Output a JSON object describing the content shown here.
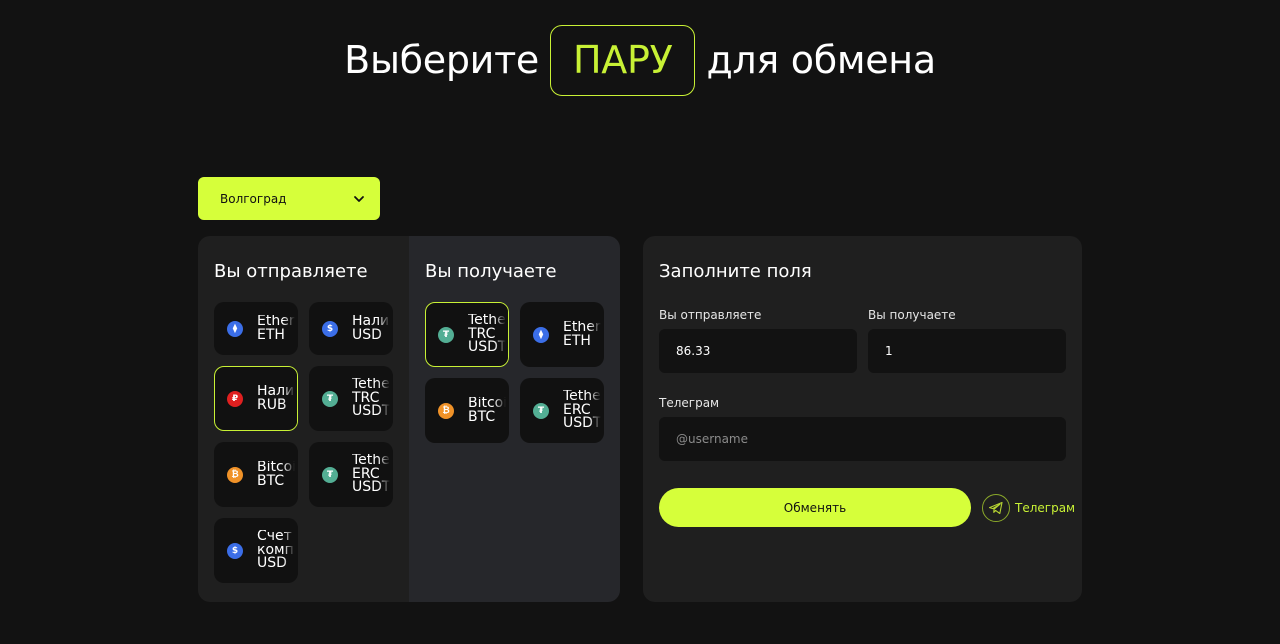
{
  "heading": {
    "before": "Выберите",
    "accent": "ПАРУ",
    "after": "для обмена"
  },
  "city": {
    "selected": "Волгоград",
    "icon": "chevron-down-icon"
  },
  "send": {
    "title": "Вы отправляете",
    "items": [
      {
        "label": "Ethereum\nETH",
        "icon": "ethereum-icon"
      },
      {
        "label": "Наличные\nUSD",
        "icon": "dollar-icon"
      },
      {
        "label": "Наличные\nRUB",
        "icon": "ruble-icon"
      },
      {
        "label": "Tether\nTRC\nUSDT",
        "icon": "tether-icon"
      },
      {
        "label": "Bitcoin\nBTC",
        "icon": "bitcoin-icon"
      },
      {
        "label": "Tether\nERC\nUSDT",
        "icon": "tether-icon"
      },
      {
        "label": "Счет\nкомпании\nUSD",
        "icon": "dollar-icon"
      }
    ]
  },
  "receive": {
    "title": "Вы получаете",
    "items": [
      {
        "label": "Tether\nTRC\nUSDT",
        "icon": "tether-icon"
      },
      {
        "label": "Ethereum\nETH",
        "icon": "ethereum-icon"
      },
      {
        "label": "Bitcoin\nBTC",
        "icon": "bitcoin-icon"
      },
      {
        "label": "Tether\nERC\nUSDT",
        "icon": "tether-icon"
      }
    ]
  },
  "form": {
    "title": "Заполните поля",
    "send_label": "Вы отправляете",
    "send_value": "86.33",
    "receive_label": "Вы получаете",
    "receive_value": "1",
    "telegram_label": "Телеграм",
    "telegram_placeholder": "@username",
    "submit_label": "Обменять",
    "telegram_link_label": "Телеграм"
  },
  "colors": {
    "accent": "#d6ff3a",
    "background": "#121212",
    "panel": "#1f1f1f"
  }
}
